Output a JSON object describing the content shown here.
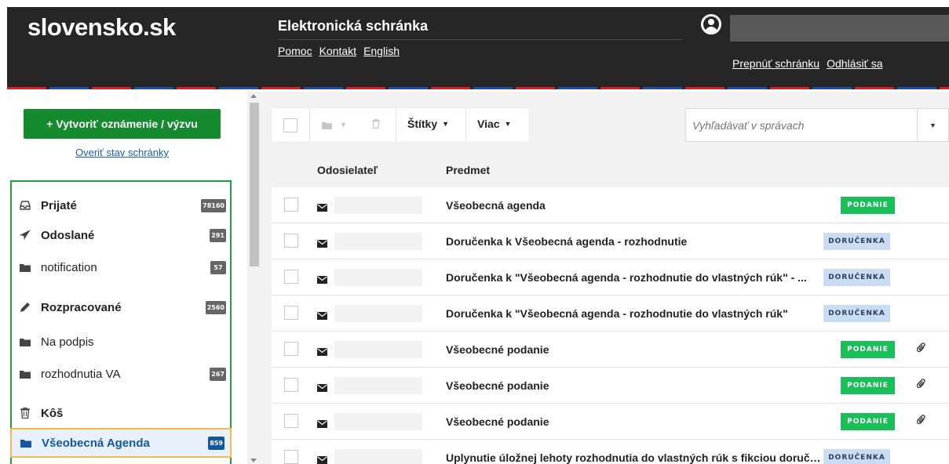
{
  "header": {
    "logo": "slovensko.sk",
    "app_title": "Elektronická schránka",
    "links": [
      "Pomoc",
      "Kontakt",
      "English"
    ],
    "switch_mailbox": "Prepnúť schránku",
    "logout": "Odhlásiť sa",
    "stripe_colors": [
      "#e01c24",
      "#ffffff",
      "#1f4fb4"
    ]
  },
  "sidebar": {
    "create_button": "+ Vytvoriť oznámenie / výzvu",
    "verify_link": "Overiť stav schránky",
    "accent_color": "#158a2e",
    "folders": [
      {
        "label": "Prijaté",
        "count": "78160",
        "icon": "inbox-icon",
        "bold": true
      },
      {
        "label": "Odoslané",
        "count": "291",
        "icon": "paper-plane-icon",
        "bold": true
      },
      {
        "label": "notification",
        "count": "57",
        "icon": "folder-icon",
        "bold": false
      },
      {
        "label": "Rozpracované",
        "count": "2560",
        "icon": "pencil-icon",
        "bold": true
      },
      {
        "label": "Na podpis",
        "count": "",
        "icon": "folder-icon",
        "bold": false
      },
      {
        "label": "rozhodnutia VA",
        "count": "267",
        "icon": "folder-icon",
        "bold": false
      },
      {
        "label": "Kôš",
        "count": "",
        "icon": "trash-icon",
        "bold": true
      },
      {
        "label": "Všeobecná Agenda",
        "count": "859",
        "icon": "folder-icon",
        "bold": true,
        "active": true
      }
    ]
  },
  "toolbar": {
    "labels_button": "Štítky",
    "more_button": "Viac",
    "search_placeholder": "Vyhľadávať v správach"
  },
  "table": {
    "columns": [
      "Odosielateľ",
      "Predmet"
    ],
    "rows": [
      {
        "subject": "Všeobecná agenda",
        "badge": "PODANIE",
        "badge_type": "podanie",
        "attachment": false
      },
      {
        "subject": "Doručenka k Všeobecná agenda - rozhodnutie",
        "badge": "DORUČENKA",
        "badge_type": "dorucenka",
        "attachment": false
      },
      {
        "subject": "Doručenka k \"Všeobecná agenda - rozhodnutie do vlastných rúk\" - ...",
        "badge": "DORUČENKA",
        "badge_type": "dorucenka",
        "attachment": false
      },
      {
        "subject": "Doručenka k \"Všeobecná agenda - rozhodnutie do vlastných rúk\"",
        "badge": "DORUČENKA",
        "badge_type": "dorucenka",
        "attachment": false
      },
      {
        "subject": "Všeobecné podanie",
        "badge": "PODANIE",
        "badge_type": "podanie",
        "attachment": true
      },
      {
        "subject": "Všeobecné podanie",
        "badge": "PODANIE",
        "badge_type": "podanie",
        "attachment": true
      },
      {
        "subject": "Všeobecné podanie",
        "badge": "PODANIE",
        "badge_type": "podanie",
        "attachment": true
      },
      {
        "subject": "Uplynutie úložnej lehoty rozhodnutia do vlastných rúk s fikciou doručenia",
        "badge": "DORUČENKA",
        "badge_type": "dorucenka",
        "attachment": false
      }
    ]
  }
}
